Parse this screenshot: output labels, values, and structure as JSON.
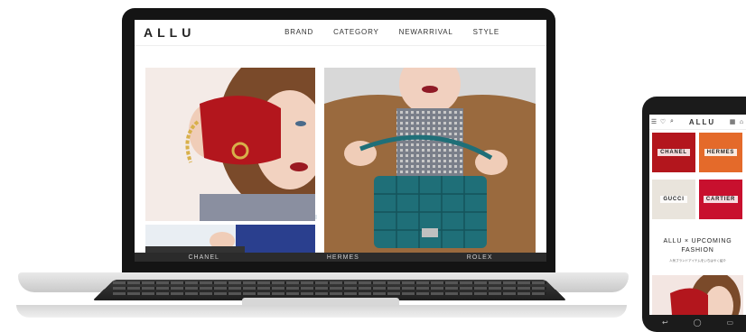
{
  "site": {
    "logo": "ALLU",
    "nav": [
      "BRAND",
      "CATEGORY",
      "NEWARRIVAL",
      "STYLE"
    ]
  },
  "laptop_strip": [
    "CHANEL",
    "HERMES",
    "ROLEX"
  ],
  "phone": {
    "logo": "ALLU",
    "tiles": [
      "CHANEL",
      "HERMES",
      "GUCCI",
      "CARTIER"
    ],
    "heading_line1": "ALLU × UPCOMING",
    "heading_line2": "FASHION",
    "subheading": "人気ブランドアイテムをいちはやく紹介"
  },
  "colors": {
    "accent_red": "#b3161d",
    "teal_bag": "#1f6f78",
    "brown_coat": "#9a6a3e",
    "dark_device": "#141414"
  },
  "icons": [
    "menu-icon",
    "heart-icon",
    "search-icon",
    "grid-icon",
    "bag-icon",
    "back-icon",
    "home-icon",
    "recent-apps-icon"
  ]
}
